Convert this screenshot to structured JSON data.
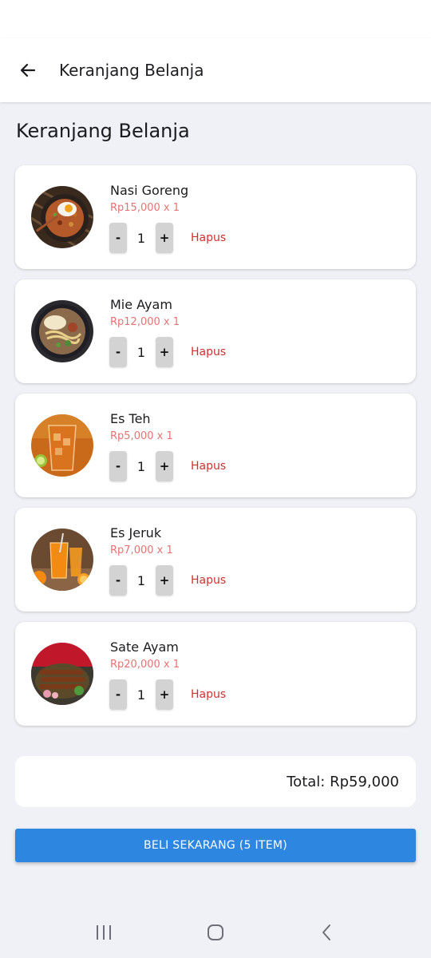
{
  "appbar": {
    "title": "Keranjang Belanja",
    "back_icon": "arrow-left-icon"
  },
  "page": {
    "title": "Keranjang Belanja"
  },
  "cart": {
    "items": [
      {
        "name": "Nasi Goreng",
        "price_text": "Rp15,000 x 1",
        "qty": "1",
        "minus": "-",
        "plus": "+",
        "remove": "Hapus",
        "image": "nasi-goreng-photo"
      },
      {
        "name": "Mie Ayam",
        "price_text": "Rp12,000 x 1",
        "qty": "1",
        "minus": "-",
        "plus": "+",
        "remove": "Hapus",
        "image": "mie-ayam-photo"
      },
      {
        "name": "Es Teh",
        "price_text": "Rp5,000 x 1",
        "qty": "1",
        "minus": "-",
        "plus": "+",
        "remove": "Hapus",
        "image": "es-teh-photo"
      },
      {
        "name": "Es Jeruk",
        "price_text": "Rp7,000 x 1",
        "qty": "1",
        "minus": "-",
        "plus": "+",
        "remove": "Hapus",
        "image": "es-jeruk-photo"
      },
      {
        "name": "Sate Ayam",
        "price_text": "Rp20,000 x 1",
        "qty": "1",
        "minus": "-",
        "plus": "+",
        "remove": "Hapus",
        "image": "sate-ayam-photo"
      }
    ]
  },
  "summary": {
    "total": "Total: Rp59,000"
  },
  "checkout": {
    "label": "BELI SEKARANG (5 ITEM)"
  },
  "colors": {
    "accent": "#2d86df",
    "price": "#e57373",
    "remove": "#d32f2f",
    "background": "#eff1f6"
  },
  "navbar": {
    "icons": [
      "recent-apps-icon",
      "home-icon",
      "back-icon"
    ]
  }
}
